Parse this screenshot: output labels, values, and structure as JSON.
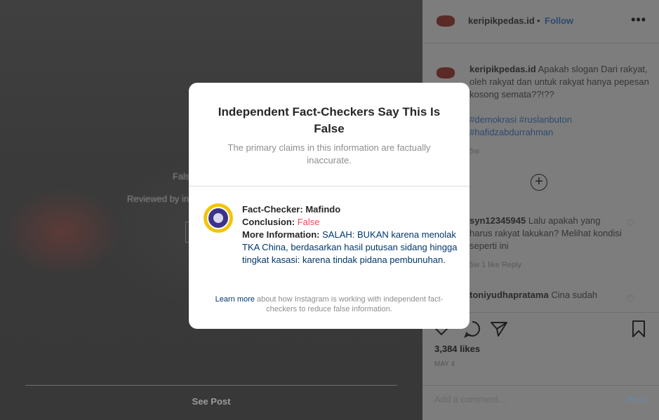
{
  "post_media": {
    "blur_false_text": "Fals",
    "blur_reviewed_text": "Reviewed by in",
    "see_post_label": "See Post"
  },
  "sidebar": {
    "header": {
      "username": "keripikpedas.id",
      "separator": "•",
      "follow_label": "Follow",
      "more_icon": "more-horizontal-icon"
    },
    "caption": {
      "username": "keripikpedas.id",
      "text": "Apakah slogan Dari rakyat, oleh rakyat dan untuk rakyat hanya pepesan kosong semata??!??",
      "hashtags": "#demokrasi #ruslanbuton #hafidzabdurrahman",
      "time": "5w"
    },
    "load_more_icon": "plus-circle-icon",
    "comments": [
      {
        "username": "syn12345945",
        "text": "Lalu apakah yang harus rakyat lakukan? Melihat kondisi seperti ini",
        "meta": "5w   1 like   Reply"
      },
      {
        "username": "toniyudhapratama",
        "text": "Cina sudah"
      }
    ],
    "likes": "3,384 likes",
    "post_date": "MAY 4",
    "comment_placeholder": "Add a comment...",
    "post_label": "Post"
  },
  "modal": {
    "title": "Independent Fact-Checkers Say This Is False",
    "subtitle": "The primary claims in this information are factually inaccurate.",
    "fact_checker_label": "Fact-Checker:",
    "fact_checker_value": "Mafindo",
    "conclusion_label": "Conclusion:",
    "conclusion_value": "False",
    "more_info_label": "More Information:",
    "more_info_value": "SALAH: BUKAN karena menolak TKA China, berdasarkan hasil putusan sidang hingga tingkat kasasi: karena tindak pidana pembunuhan.",
    "learn_more_label": "Learn more",
    "footer_text": " about how Instagram is working with independent fact-checkers to reduce false information."
  },
  "colors": {
    "false_red": "#ed4956",
    "link_blue": "#00376b",
    "badge_gold": "#f2c40b",
    "badge_purple": "#3b3389"
  }
}
